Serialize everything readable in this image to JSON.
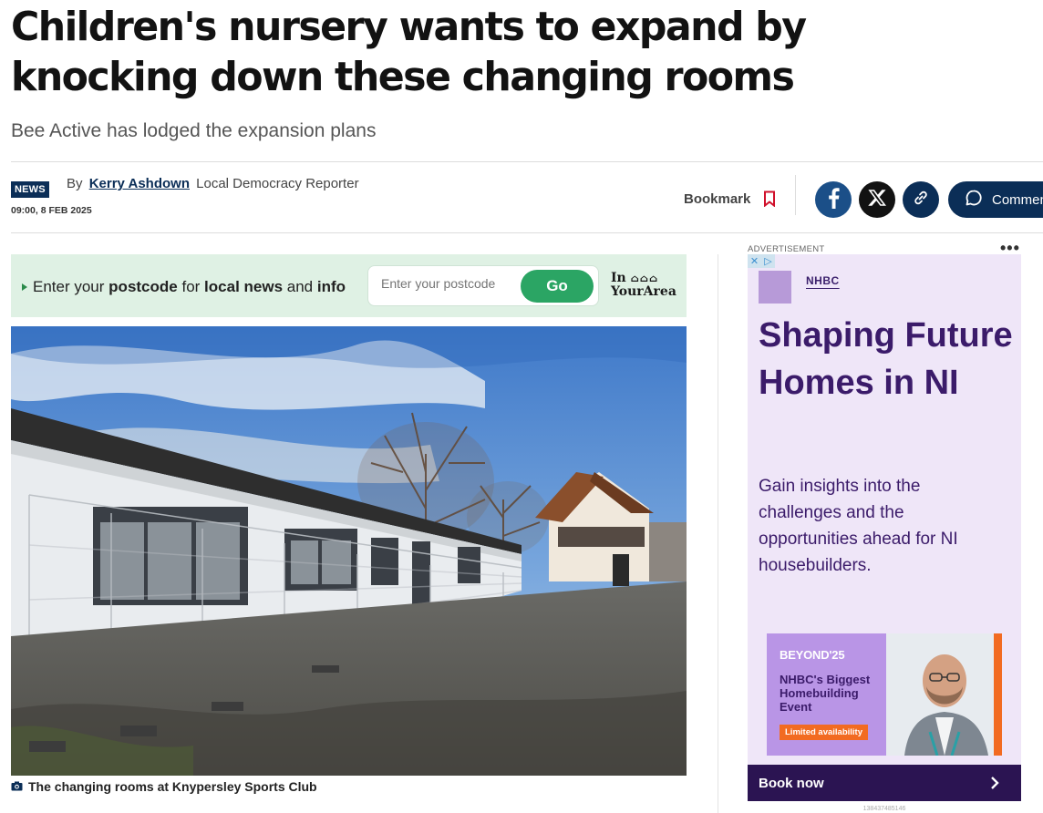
{
  "article": {
    "headline": "Children's nursery wants to expand by knocking down these changing rooms",
    "standfirst": "Bee Active has lodged the expansion plans",
    "category": "NEWS",
    "by": "By",
    "author": "Kerry Ashdown",
    "author_role": "Local Democracy Reporter",
    "date": "09:00, 8 FEB 2025"
  },
  "toolbar": {
    "bookmark_label": "Bookmark",
    "comments_label": "Comments"
  },
  "postcode": {
    "prefix": "Enter your",
    "kw1": "postcode",
    "mid1": "for",
    "kw2": "local news",
    "mid2": "and",
    "kw3": "info",
    "placeholder": "Enter your postcode",
    "go_label": "Go",
    "logo_line1": "In",
    "logo_line2": "YourArea"
  },
  "photo": {
    "caption": "The changing rooms at Knypersley Sports Club"
  },
  "ad": {
    "label": "ADVERTISEMENT",
    "brand": "NHBC",
    "headline": "Shaping Future Homes in NI",
    "body": "Gain insights into the challenges and the opportunities ahead for NI housebuilders.",
    "banner_title": "BEYOND'25",
    "banner_text": "NHBC's Biggest Homebuilding Event",
    "banner_badge": "Limited availability",
    "cta": "Book now",
    "id": "138437485146"
  },
  "colors": {
    "brand_navy": "#0b2e57",
    "go_green": "#2ba564",
    "ad_purple": "#3b1b6a",
    "ad_bg": "#efe6f8"
  }
}
